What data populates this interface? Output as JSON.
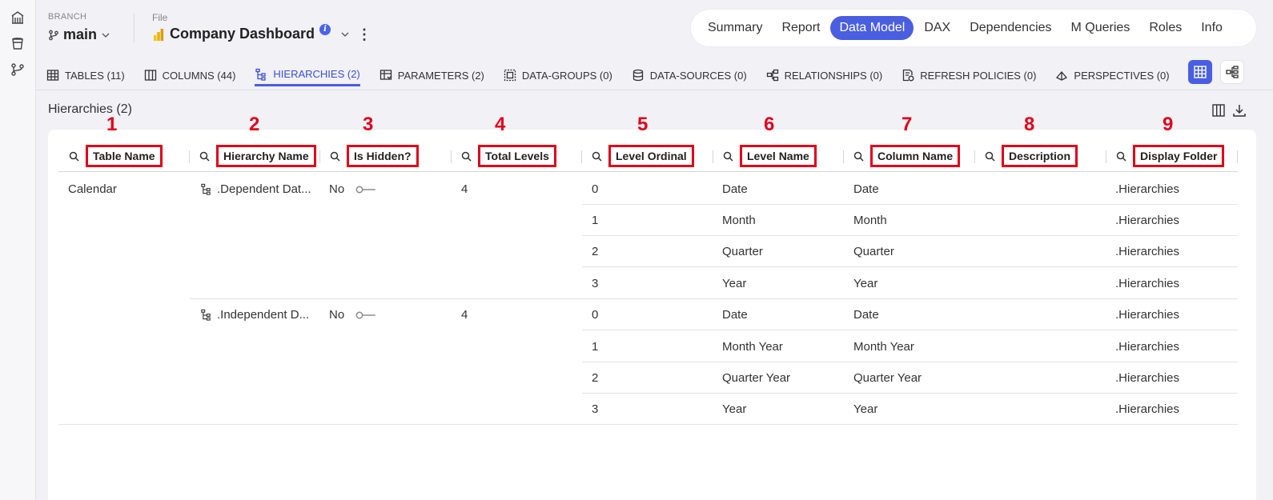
{
  "header": {
    "branch_label": "BRANCH",
    "branch_value": "main",
    "file_label": "File",
    "file_value": "Company Dashboard",
    "info_badge": "i"
  },
  "top_nav": [
    "Summary",
    "Report",
    "Data Model",
    "DAX",
    "Dependencies",
    "M Queries",
    "Roles",
    "Info"
  ],
  "top_nav_active": "Data Model",
  "sub_tabs": [
    {
      "label": "TABLES (11)",
      "icon": "table-icon"
    },
    {
      "label": "COLUMNS (44)",
      "icon": "columns-icon"
    },
    {
      "label": "HIERARCHIES (2)",
      "icon": "hierarchy-icon",
      "active": true
    },
    {
      "label": "PARAMETERS (2)",
      "icon": "parameters-icon"
    },
    {
      "label": "DATA-GROUPS (0)",
      "icon": "data-groups-icon"
    },
    {
      "label": "DATA-SOURCES (0)",
      "icon": "database-icon"
    },
    {
      "label": "RELATIONSHIPS (0)",
      "icon": "relationships-icon"
    },
    {
      "label": "REFRESH POLICIES (0)",
      "icon": "refresh-policy-icon"
    },
    {
      "label": "PERSPECTIVES (0)",
      "icon": "perspectives-icon"
    }
  ],
  "section_title": "Hierarchies (2)",
  "columns": [
    {
      "num": "1",
      "label": "Table Name"
    },
    {
      "num": "2",
      "label": "Hierarchy Name"
    },
    {
      "num": "3",
      "label": "Is Hidden?"
    },
    {
      "num": "4",
      "label": "Total Levels"
    },
    {
      "num": "5",
      "label": "Level Ordinal"
    },
    {
      "num": "6",
      "label": "Level Name"
    },
    {
      "num": "7",
      "label": "Column Name"
    },
    {
      "num": "8",
      "label": "Description"
    },
    {
      "num": "9",
      "label": "Display Folder"
    }
  ],
  "table_name": "Calendar",
  "hierarchies": [
    {
      "name": ".Dependent Dat...",
      "hidden": "No",
      "total_levels": "4",
      "levels": [
        {
          "ordinal": "0",
          "level_name": "Date",
          "column_name": "Date",
          "folder": ".Hierarchies"
        },
        {
          "ordinal": "1",
          "level_name": "Month",
          "column_name": "Month",
          "folder": ".Hierarchies"
        },
        {
          "ordinal": "2",
          "level_name": "Quarter",
          "column_name": "Quarter",
          "folder": ".Hierarchies"
        },
        {
          "ordinal": "3",
          "level_name": "Year",
          "column_name": "Year",
          "folder": ".Hierarchies"
        }
      ]
    },
    {
      "name": ".Independent D...",
      "hidden": "No",
      "total_levels": "4",
      "levels": [
        {
          "ordinal": "0",
          "level_name": "Date",
          "column_name": "Date",
          "folder": ".Hierarchies"
        },
        {
          "ordinal": "1",
          "level_name": "Month Year",
          "column_name": "Month Year",
          "folder": ".Hierarchies"
        },
        {
          "ordinal": "2",
          "level_name": "Quarter Year",
          "column_name": "Quarter Year",
          "folder": ".Hierarchies"
        },
        {
          "ordinal": "3",
          "level_name": "Year",
          "column_name": "Year",
          "folder": ".Hierarchies"
        }
      ]
    }
  ],
  "colors": {
    "accent": "#4a5ee0",
    "annotation": "#e0001a"
  }
}
